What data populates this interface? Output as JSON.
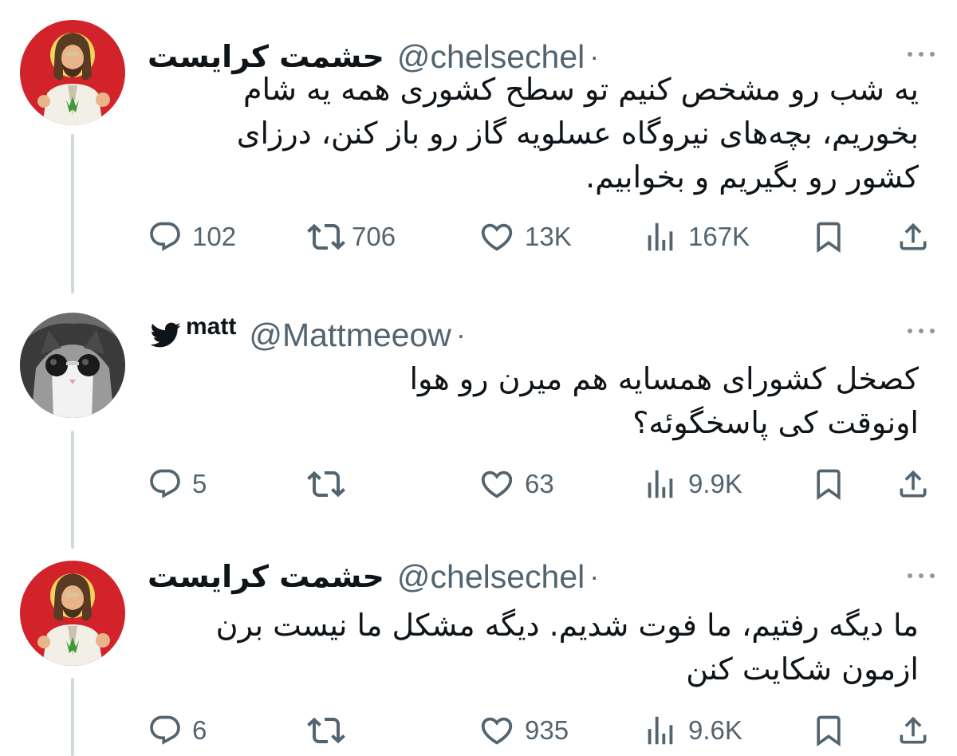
{
  "tweets": [
    {
      "display_name": "حشمت کرایست",
      "handle": "@chelsechel",
      "separator": "·",
      "avatar": "jesus-avatar",
      "body_lines": [
        "یه شب رو مشخص کنیم تو سطح کشوری همه یه شام",
        "بخوریم، بچه‌های نیروگاه عسلویه گاز رو باز کنن، درزای",
        "کشور رو بگیریم و بخوابیم."
      ],
      "replies": "102",
      "reposts": "706",
      "likes": "13K",
      "views": "167K"
    },
    {
      "display_name": "matt",
      "handle": "@Mattmeeow",
      "separator": "·",
      "avatar": "cat-avatar",
      "name_icon": "twitter-bird-icon",
      "body_lines": [
        "کصخل کشورای همسایه هم میرن رو هوا",
        "اونوقت کی پاسخگوئه؟"
      ],
      "replies": "5",
      "reposts": "",
      "likes": "63",
      "views": "9.9K"
    },
    {
      "display_name": "حشمت کرایست",
      "handle": "@chelsechel",
      "separator": "·",
      "avatar": "jesus-avatar",
      "body_lines": [
        "ما دیگه رفتیم، ما فوت شدیم. دیگه مشکل ما نیست برن",
        "ازمون شکایت کنن"
      ],
      "replies": "6",
      "reposts": "",
      "likes": "935",
      "views": "9.6K"
    }
  ],
  "colors": {
    "text": "#0f1419",
    "secondary": "#536471",
    "thread_line": "#cfd9de",
    "avatar_red": "#d2232a"
  }
}
